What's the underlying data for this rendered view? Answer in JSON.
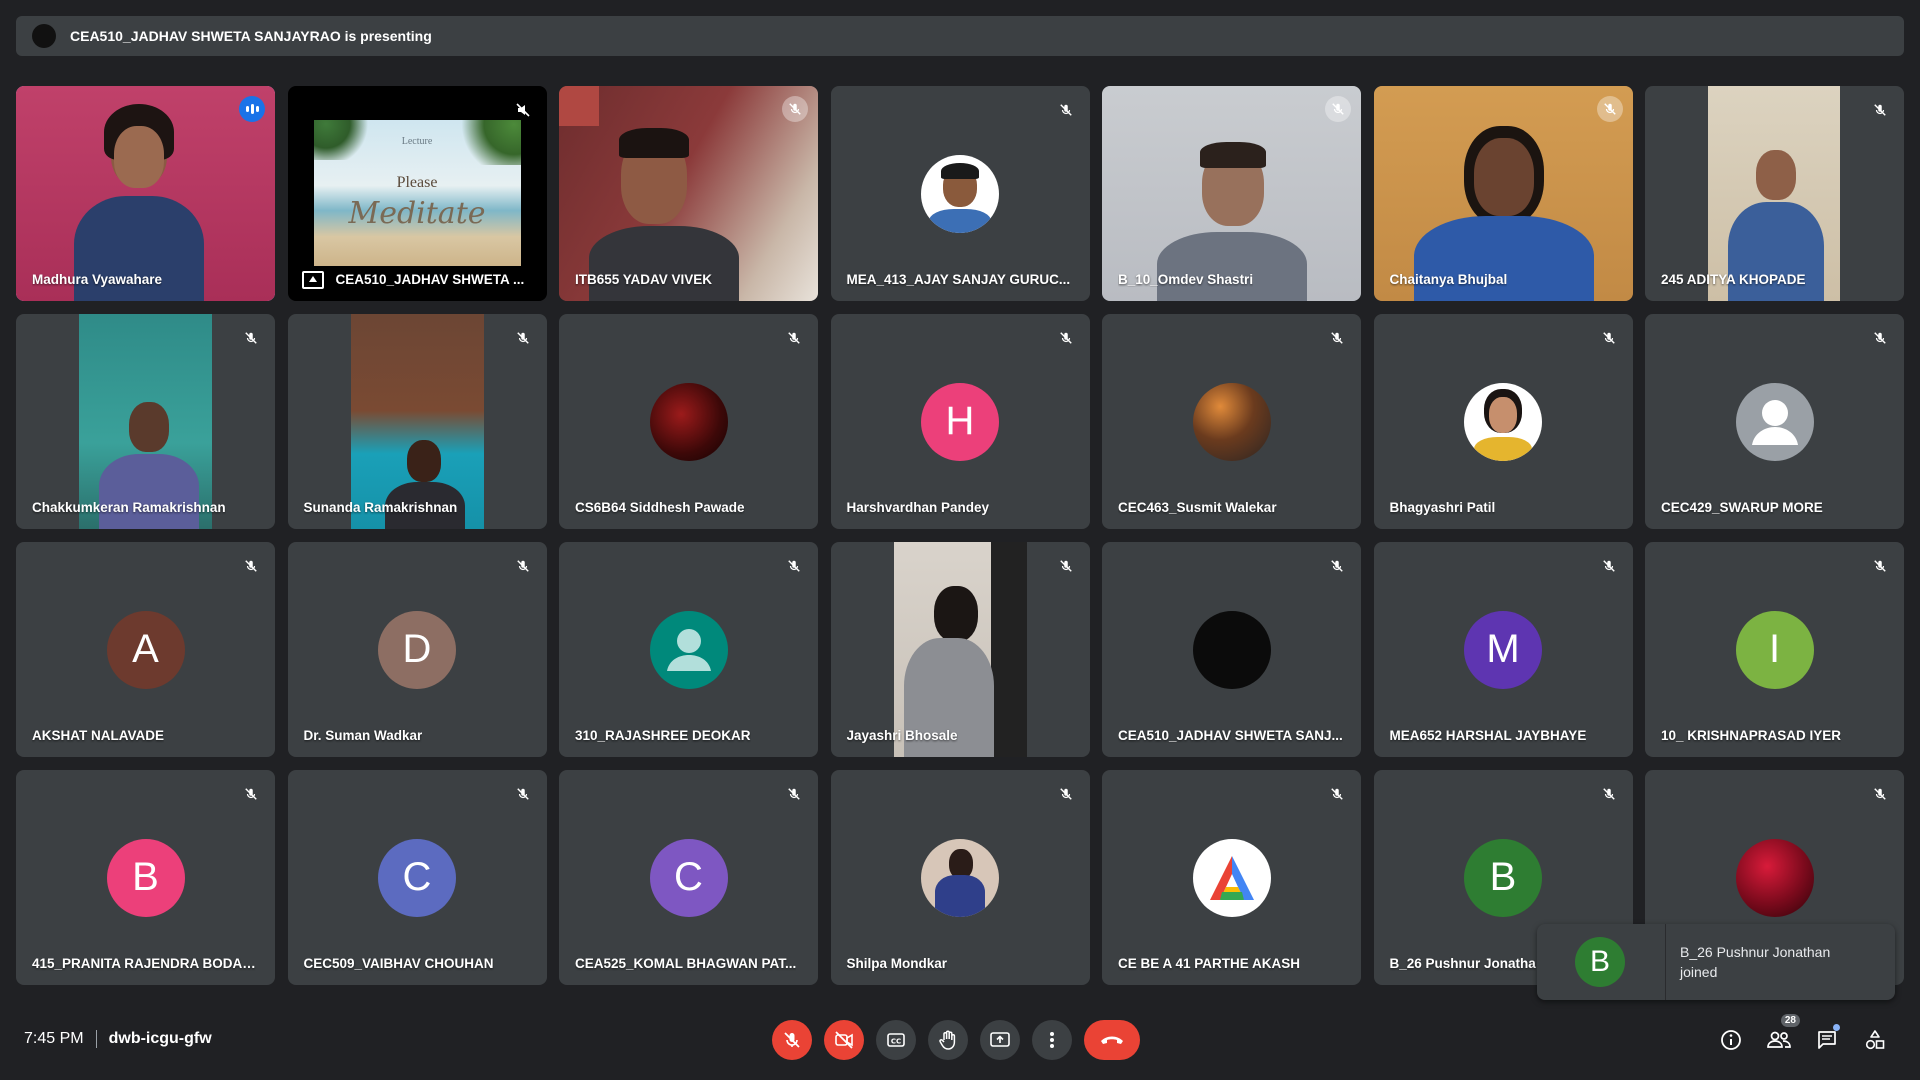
{
  "presenting": {
    "text": "CEA510_JADHAV SHWETA SANJAYRAO is presenting"
  },
  "tiles": [
    {
      "name": "Madhura Vyawahare"
    },
    {
      "name": "CEA510_JADHAV SHWETA ...",
      "slide_small": "Lecture",
      "slide_line1": "Please",
      "slide_line2": "Meditate"
    },
    {
      "name": "ITB655 YADAV VIVEK"
    },
    {
      "name": "MEA_413_AJAY SANJAY GURUC..."
    },
    {
      "name": "B_10_Omdev Shastri"
    },
    {
      "name": "Chaitanya Bhujbal"
    },
    {
      "name": "245 ADITYA KHOPADE"
    },
    {
      "name": "Chakkumkeran Ramakrishnan"
    },
    {
      "name": "Sunanda Ramakrishnan"
    },
    {
      "name": "CS6B64 Siddhesh Pawade"
    },
    {
      "name": "Harshvardhan Pandey",
      "initial": "H"
    },
    {
      "name": "CEC463_Susmit Walekar"
    },
    {
      "name": "Bhagyashri Patil"
    },
    {
      "name": "CEC429_SWARUP MORE"
    },
    {
      "name": "AKSHAT NALAVADE",
      "initial": "A"
    },
    {
      "name": "Dr. Suman Wadkar",
      "initial": "D"
    },
    {
      "name": "310_RAJASHREE DEOKAR"
    },
    {
      "name": "Jayashri Bhosale"
    },
    {
      "name": "CEA510_JADHAV SHWETA SANJ..."
    },
    {
      "name": "MEA652 HARSHAL JAYBHAYE",
      "initial": "M"
    },
    {
      "name": "10_ KRISHNAPRASAD IYER",
      "initial": "I"
    },
    {
      "name": "415_PRANITA RAJENDRA BODALA",
      "initial": "B"
    },
    {
      "name": "CEC509_VAIBHAV CHOUHAN",
      "initial": "C"
    },
    {
      "name": "CEA525_KOMAL BHAGWAN PAT...",
      "initial": "C"
    },
    {
      "name": "Shilpa Mondkar"
    },
    {
      "name": "CE BE A 41 PARTHE AKASH"
    },
    {
      "name": "B_26 Pushnur Jonatha",
      "initial": "B"
    },
    {
      "name": ""
    }
  ],
  "toast": {
    "initial": "B",
    "line1": "B_26 Pushnur Jonathan",
    "line2": "joined"
  },
  "meeting": {
    "time": "7:45 PM",
    "code": "dwb-icgu-gfw"
  },
  "people_count": "28",
  "colors": {
    "bg": "#202124",
    "tile": "#3c4043",
    "accent": "#8ab4f8",
    "red": "#ea4335"
  }
}
